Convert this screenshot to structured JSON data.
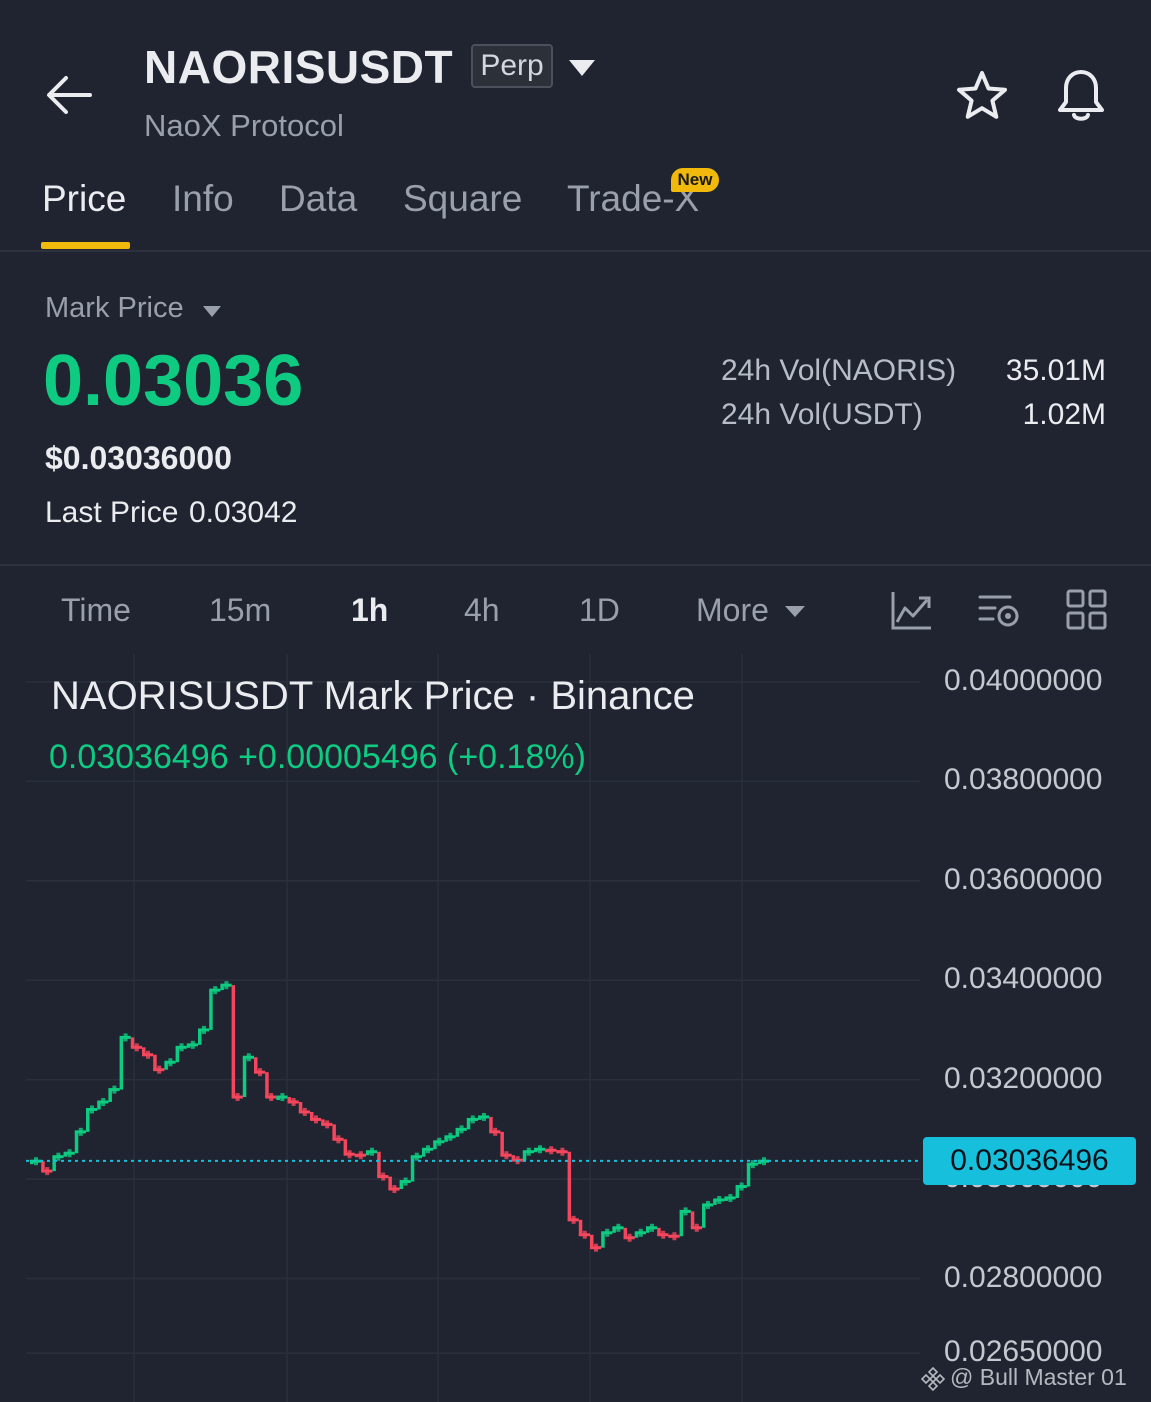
{
  "header": {
    "symbol": "NAORISUSDT",
    "badge": "Perp",
    "subtitle": "NaoX Protocol"
  },
  "tabs": [
    {
      "label": "Price",
      "active": true
    },
    {
      "label": "Info"
    },
    {
      "label": "Data"
    },
    {
      "label": "Square"
    },
    {
      "label": "Trade-X",
      "badge": "New"
    }
  ],
  "price": {
    "mark_label": "Mark Price",
    "mark_price": "0.03036",
    "usd_price": "$0.03036000",
    "last_label": "Last Price",
    "last_value": "0.03042",
    "vol_base_label": "24h Vol(NAORIS)",
    "vol_base_value": "35.01M",
    "vol_quote_label": "24h Vol(USDT)",
    "vol_quote_value": "1.02M"
  },
  "timeframes": {
    "items": [
      "Time",
      "15m",
      "1h",
      "4h",
      "1D"
    ],
    "active": "1h",
    "more": "More"
  },
  "chart_header": {
    "title": "NAORISUSDT Mark Price · Binance",
    "ohlc": "0.03036496  +0.00005496 (+0.18%)"
  },
  "chart_data": {
    "type": "line",
    "title": "NAORISUSDT Mark Price · Binance",
    "y_ticks": [
      "0.04000000",
      "0.03800000",
      "0.03600000",
      "0.03400000",
      "0.03200000",
      "0.03000000",
      "0.02800000",
      "0.02650000"
    ],
    "current_price": "0.03036496",
    "ylim": [
      0.0262,
      0.0404
    ],
    "series": [
      {
        "values": [
          0.03036,
          0.03016,
          0.03045,
          0.03052,
          0.03095,
          0.0314,
          0.03155,
          0.0318,
          0.03285,
          0.03265,
          0.0325,
          0.0322,
          0.03235,
          0.03265,
          0.0327,
          0.033,
          0.0338,
          0.0339,
          0.03165,
          0.03245,
          0.03215,
          0.03165,
          0.03165,
          0.03155,
          0.03135,
          0.0312,
          0.0311,
          0.0308,
          0.0305,
          0.03048,
          0.03055,
          0.03005,
          0.0298,
          0.02995,
          0.03045,
          0.0306,
          0.03075,
          0.03085,
          0.031,
          0.0312,
          0.03125,
          0.03095,
          0.03048,
          0.03038,
          0.03055,
          0.0306,
          0.03058,
          0.03055,
          0.02918,
          0.02888,
          0.02862,
          0.02892,
          0.02902,
          0.02882,
          0.02892,
          0.02902,
          0.02888,
          0.02885,
          0.02935,
          0.02902,
          0.02948,
          0.02958,
          0.02962,
          0.02985,
          0.0303,
          0.03036
        ]
      }
    ],
    "up_color": "#0ecb81",
    "down_color": "#f6465d",
    "price_line_color": "#16c0dd"
  },
  "watermark": "@ Bull Master 01",
  "icons": [
    "back-arrow-icon",
    "chevron-down-icon",
    "star-icon",
    "bell-icon",
    "indicator-icon",
    "chart-settings-icon",
    "layout-grid-icon",
    "binance-logo-icon"
  ]
}
